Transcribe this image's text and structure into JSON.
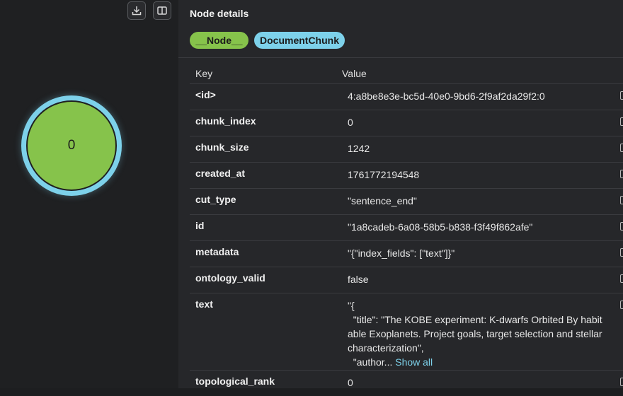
{
  "toolbar": {
    "download_icon": "download-icon",
    "panel_icon": "panel-toggle-icon"
  },
  "graph": {
    "node_label": "0",
    "node_fill": "#86c34b",
    "node_ring": "#7dd1ea"
  },
  "details": {
    "title": "Node details",
    "labels": [
      "__Node__",
      "DocumentChunk"
    ],
    "columns": {
      "key": "Key",
      "value": "Value"
    },
    "rows": [
      {
        "key": "<id>",
        "value": "4:a8be8e3e-bc5d-40e0-9bd6-2f9af2da29f2:0"
      },
      {
        "key": "chunk_index",
        "value": "0"
      },
      {
        "key": "chunk_size",
        "value": "1242"
      },
      {
        "key": "created_at",
        "value": "1761772194548"
      },
      {
        "key": "cut_type",
        "value": "\"sentence_end\""
      },
      {
        "key": "id",
        "value": "\"1a8cadeb-6a08-58b5-b838-f3f49f862afe\""
      },
      {
        "key": "metadata",
        "value": "\"{\"index_fields\": [\"text\"]}\""
      },
      {
        "key": "ontology_valid",
        "value": "false"
      },
      {
        "key": "text",
        "value": "\"{\n  \"title\": \"The KOBE experiment: K-dwarfs Orbited By habit\nable Exoplanets. Project goals, target selection and stellar\ncharacterization\",\n  \"author...",
        "show_all": "Show all"
      },
      {
        "key": "topological_rank",
        "value": "0"
      }
    ]
  }
}
